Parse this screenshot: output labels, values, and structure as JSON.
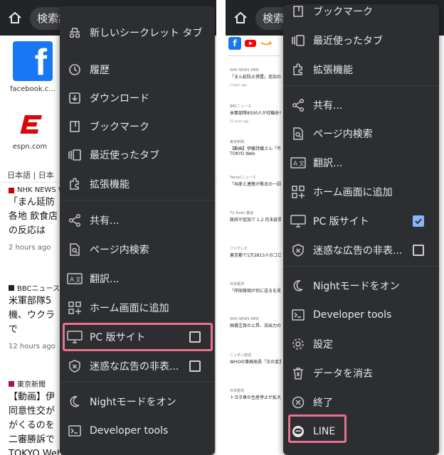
{
  "colors": {
    "menu_bg": "#2d2e31",
    "menu_text": "#e8eaed",
    "topbar_bg": "#222428",
    "highlight": "#e8728f",
    "checkbox_checked": "#8ab4f8",
    "facebook": "#1877f2",
    "espn": "#d50a0a"
  },
  "left": {
    "omnibox_text": "検索語",
    "tiles": [
      {
        "label": "facebook.c...",
        "icon": "facebook-icon"
      },
      {
        "label": "espn.com",
        "icon": "espn-icon"
      }
    ],
    "language": "日本語 | 日本",
    "news": [
      {
        "source": "NHK NEWS W",
        "title1": "「まん延防",
        "title2": "各地 飲食店",
        "title3": "の反応は",
        "time": "2 hours ago"
      },
      {
        "source": "BBCニュース",
        "title1": "米軍部隊5",
        "title2": "機、ウクラ",
        "title3": "で",
        "time": "12 hours ago"
      },
      {
        "source": "東京新聞",
        "title1": "【動画】伊",
        "title2": "同意性交が",
        "title3": "がくるのを",
        "title4": "二審勝訴で",
        "title5": "TOKYO Web"
      }
    ],
    "menu": [
      {
        "label": "新しいシークレット タブ",
        "icon": "incognito-icon"
      },
      {
        "label": "履歴",
        "icon": "history-icon"
      },
      {
        "label": "ダウンロード",
        "icon": "download-icon"
      },
      {
        "label": "ブックマーク",
        "icon": "bookmark-icon"
      },
      {
        "label": "最近使ったタブ",
        "icon": "recent-tabs-icon"
      },
      {
        "label": "拡張機能",
        "icon": "extensions-icon"
      },
      {
        "label": "共有...",
        "icon": "share-icon"
      },
      {
        "label": "ページ内検索",
        "icon": "find-in-page-icon"
      },
      {
        "label": "翻訳...",
        "icon": "translate-icon"
      },
      {
        "label": "ホーム画面に追加",
        "icon": "add-to-home-icon"
      },
      {
        "label": "PC 版サイト",
        "icon": "desktop-icon",
        "checked": false
      },
      {
        "label": "迷惑な広告の非表...",
        "icon": "shield-icon",
        "checked": false
      },
      {
        "label": "Nightモードをオン",
        "icon": "moon-icon"
      },
      {
        "label": "Developer tools",
        "icon": "terminal-icon"
      }
    ]
  },
  "right": {
    "omnibox_text": "検索語",
    "news": [
      {
        "source": "NHK NEWS WEB",
        "title": "「まん延防止措置」追加の各地 飲食",
        "time": "2 hours ago"
      },
      {
        "source": "BBCニュース",
        "title": "米軍部隊8500人が待機命令、ウク",
        "time": "12 hours ago"
      },
      {
        "source": "東京新聞",
        "title": "【動画】伊藤詩織さん「不同意性交",
        "title2": "TOKYO Web",
        "time": ""
      },
      {
        "source": "Yahoo!ニュース",
        "title": "「共産と連携が敗北の一因」と批判",
        "time": ""
      },
      {
        "source": "TV Asahi 報道",
        "title": "政府が追加で 1,2 月末延長を検討",
        "time": ""
      },
      {
        "source": "フジテレビ",
        "title": "東京都で1万2813人のコロナ感染",
        "time": ""
      },
      {
        "source": "日本経済",
        "title": "「岸田首相が何に送るを見」",
        "time": ""
      },
      {
        "source": "NHK NEWS WEB",
        "title": "国債注目の上昇、流出力の高校授業",
        "time": ""
      },
      {
        "source": "ニッポン放送",
        "title": "WHOの事務局長「次の変異株が",
        "time": ""
      },
      {
        "source": "日本経済",
        "title": "トヨタ車の生産停止が拡大 国内",
        "time": ""
      }
    ],
    "menu": [
      {
        "label": "ブックマーク",
        "icon": "bookmark-icon"
      },
      {
        "label": "最近使ったタブ",
        "icon": "recent-tabs-icon"
      },
      {
        "label": "拡張機能",
        "icon": "extensions-icon"
      },
      {
        "label": "共有...",
        "icon": "share-icon"
      },
      {
        "label": "ページ内検索",
        "icon": "find-in-page-icon"
      },
      {
        "label": "翻訳...",
        "icon": "translate-icon"
      },
      {
        "label": "ホーム画面に追加",
        "icon": "add-to-home-icon"
      },
      {
        "label": "PC 版サイト",
        "icon": "desktop-icon",
        "checked": true
      },
      {
        "label": "迷惑な広告の非表...",
        "icon": "shield-icon",
        "checked": false
      },
      {
        "label": "Nightモードをオン",
        "icon": "moon-icon"
      },
      {
        "label": "Developer tools",
        "icon": "terminal-icon"
      },
      {
        "label": "設定",
        "icon": "settings-icon"
      },
      {
        "label": "データを消去",
        "icon": "trash-icon"
      },
      {
        "label": "終了",
        "icon": "close-circle-icon"
      },
      {
        "label": "LINE",
        "icon": "line-app-icon"
      }
    ]
  }
}
